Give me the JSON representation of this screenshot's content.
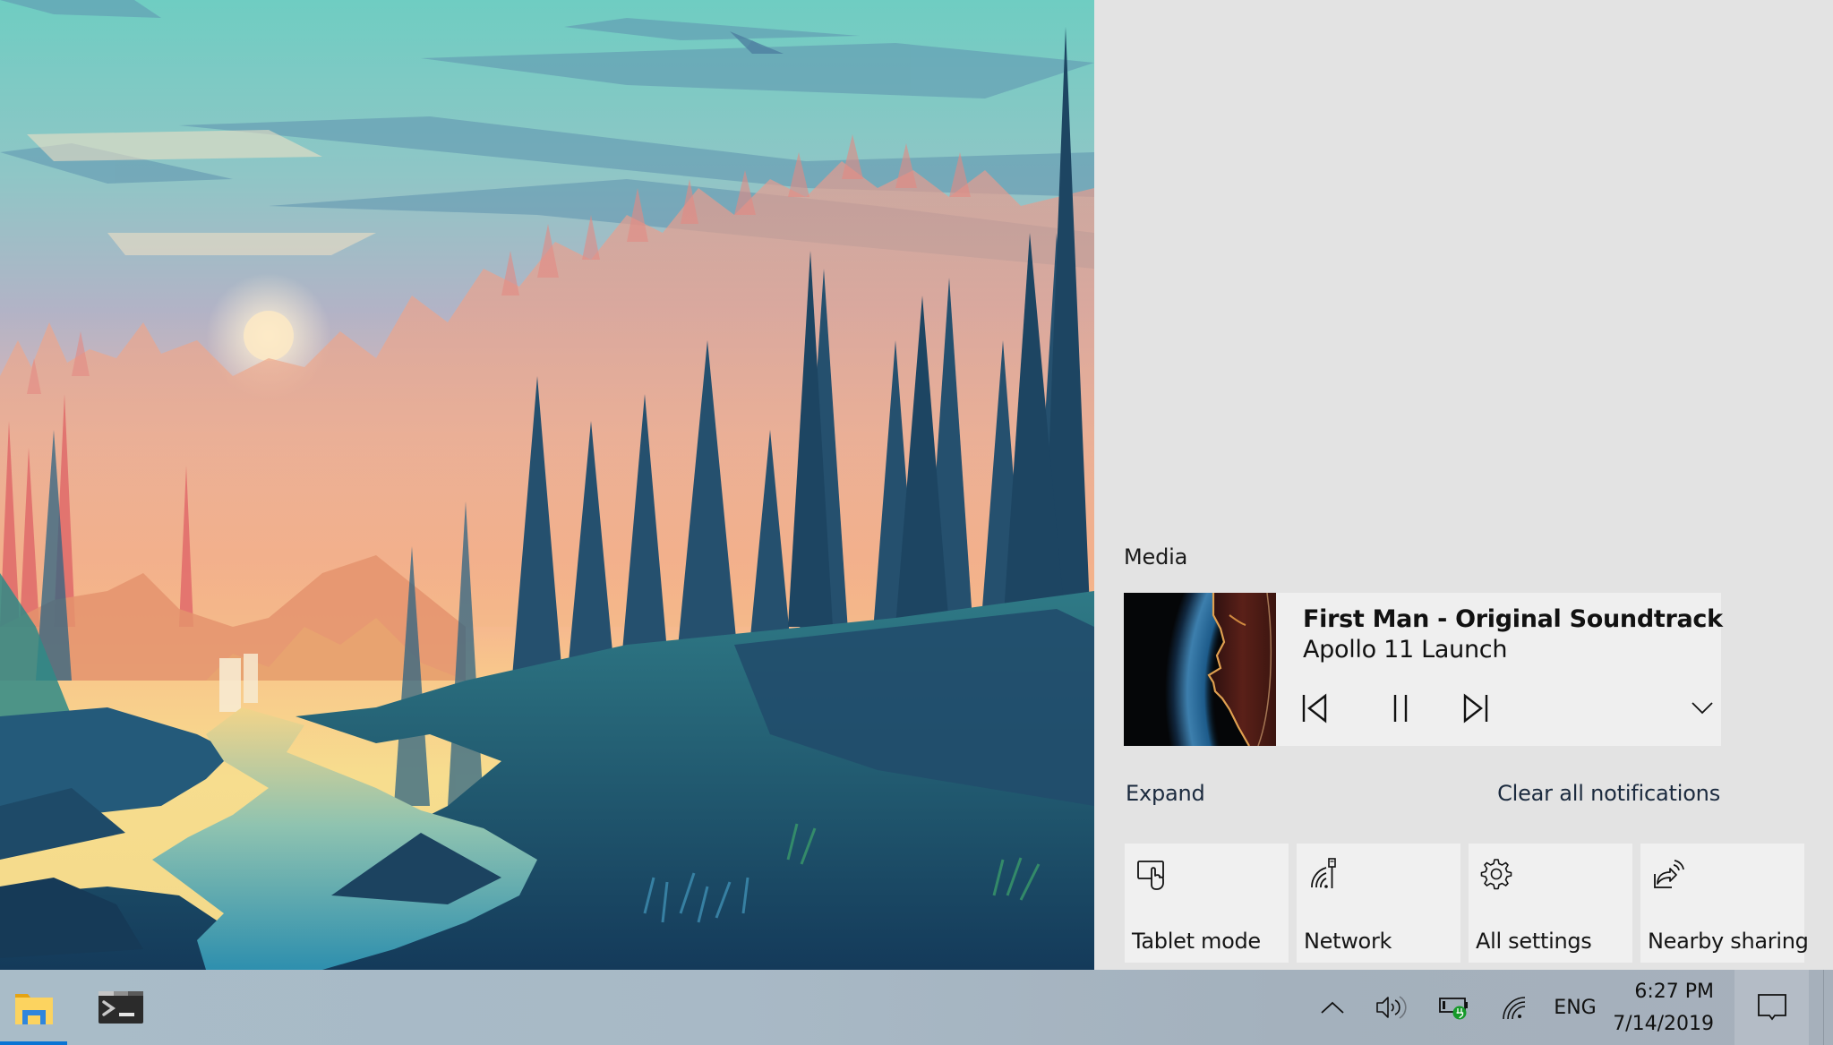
{
  "desktop": {
    "wallpaper": "Illustrated forest valley at sunset with river and pine trees",
    "colors": {
      "sky_top": "#6cc9c1",
      "sky_mid": "#a8b6c8",
      "sunset_pink": "#ec8f84",
      "sunset_yellow": "#f7d98a",
      "forest_dark": "#1f4d6b",
      "river": "#4fb3bf"
    }
  },
  "action_center": {
    "background": "#e3e3e3",
    "media": {
      "heading": "Media",
      "album_art_alt": "First Man album art",
      "title": "First Man - Original Soundtrack",
      "subtitle": "Apollo 11 Launch",
      "controls": {
        "previous": "Previous track",
        "pause": "Pause",
        "next": "Next track",
        "expand": "Show more"
      },
      "state": "playing"
    },
    "links": {
      "expand": "Expand",
      "clear_all": "Clear all notifications"
    },
    "quick_actions": [
      {
        "label": "Tablet mode",
        "icon": "tablet-mode-icon"
      },
      {
        "label": "Network",
        "icon": "network-icon"
      },
      {
        "label": "All settings",
        "icon": "gear-icon"
      },
      {
        "label": "Nearby sharing",
        "icon": "nearby-sharing-icon"
      }
    ]
  },
  "taskbar": {
    "accent": "#0a74d4",
    "apps": [
      {
        "name": "File Explorer",
        "icon": "file-explorer-icon",
        "active": true
      },
      {
        "name": "Windows Terminal",
        "icon": "terminal-icon",
        "active": false
      }
    ],
    "tray": {
      "show_hidden": "Show hidden icons",
      "volume": "Speakers",
      "battery": "Battery charging",
      "network": "Wi-Fi",
      "language": "ENG"
    },
    "clock": {
      "time": "6:27 PM",
      "date": "7/14/2019"
    },
    "notifications_label": "Action Center"
  }
}
